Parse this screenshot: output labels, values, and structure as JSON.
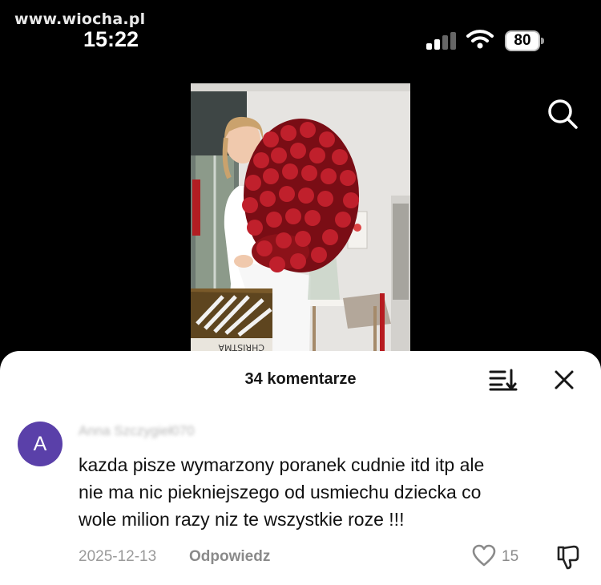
{
  "watermark": "www.wiocha.pl",
  "status_bar": {
    "time": "15:22",
    "battery": "80",
    "signal_icon": "signal-bars-icon",
    "wifi_icon": "wifi-icon"
  },
  "video": {
    "search_icon": "search-icon",
    "box_text": "CHRISTMA"
  },
  "comments_sheet": {
    "title": "34 komentarze",
    "sort_icon": "sort-icon",
    "close_icon": "close-icon",
    "comment": {
      "avatar_letter": "A",
      "username": "Anna Szczygieł070",
      "text_lines": [
        "kazda pisze wymarzony poranek cudnie itd itp ale",
        "nie ma nic piekniejszego od usmiechu dziecka co",
        "wole milion razy niz te wszystkie roze !!!"
      ],
      "date": "2025-12-13",
      "reply_label": "Odpowiedz",
      "likes": "15",
      "like_icon": "heart-icon",
      "dislike_icon": "thumbs-down-icon"
    }
  },
  "colors": {
    "avatar_bg": "#5a40a9",
    "rose": "#b0141f",
    "sheet_bg": "#ffffff",
    "screen_bg": "#000000"
  }
}
